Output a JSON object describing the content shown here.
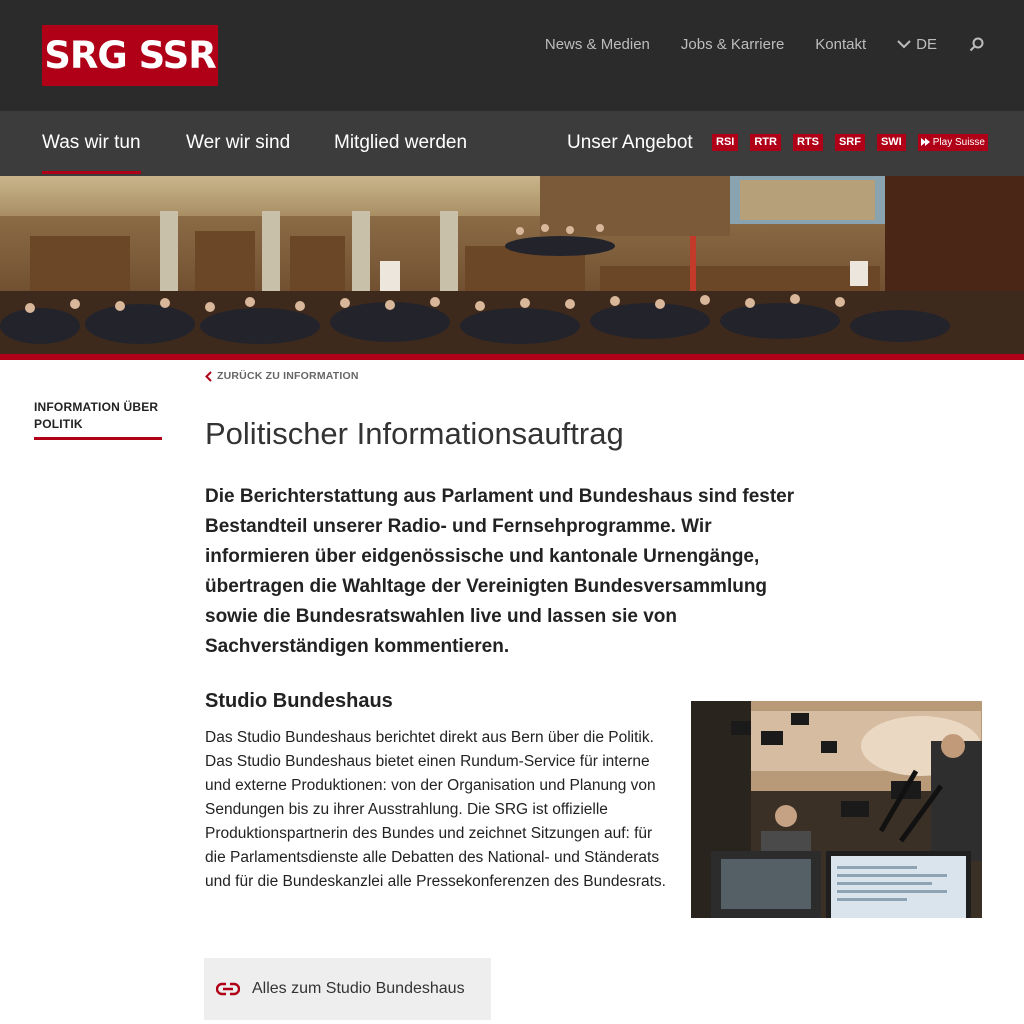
{
  "header": {
    "logo_text": "SRG SSR",
    "top_links": [
      "News & Medien",
      "Jobs & Karriere",
      "Kontakt"
    ],
    "language": "DE"
  },
  "main_nav": {
    "items": [
      "Was wir tun",
      "Wer wir sind",
      "Mitglied werden"
    ],
    "offer_label": "Unser Angebot",
    "units": [
      "RSI",
      "RTR",
      "RTS",
      "SRF",
      "SWI"
    ],
    "play_label": "Play Suisse"
  },
  "sidebar": {
    "label": "INFORMATION ÜBER POLITIK"
  },
  "content": {
    "back_link": "ZURÜCK ZU INFORMATION",
    "title": "Politischer Informationsauftrag",
    "lead": "Die Berichterstattung aus Parlament und Bundeshaus sind fester Bestandteil unserer Radio- und Fernsehprogramme. Wir informieren über eidgenössische und kantonale Urnengänge, übertragen die Wahltage der Vereinigten Bundesversammlung sowie die Bundesratswahlen live und lassen sie von Sachverständigen kommentieren.",
    "subtitle": "Studio Bundeshaus",
    "body": "Das Studio Bundeshaus berichtet direkt aus Bern über die Politik. Das Studio Bundeshaus bietet einen Rundum-Service für interne und externe Produktionen: von der Organisation und Planung von Sendungen bis zu ihrer Ausstrahlung. Die SRG ist offizielle Produktionspartnerin des Bundes und zeichnet Sitzungen auf: für die Parlamentsdienste alle Debatten des National- und Ständerats und für die Bundeskanzlei alle Pressekonferenzen des Bundesrats.",
    "link_button": "Alles zum Studio Bundeshaus"
  },
  "colors": {
    "brand_red": "#af0018",
    "topbar": "#2b2b2b",
    "navbar": "#3c3c3c"
  },
  "icons": [
    "chevron-down-icon",
    "search-icon",
    "play-arrow-icon",
    "chevron-left-icon",
    "link-icon"
  ]
}
